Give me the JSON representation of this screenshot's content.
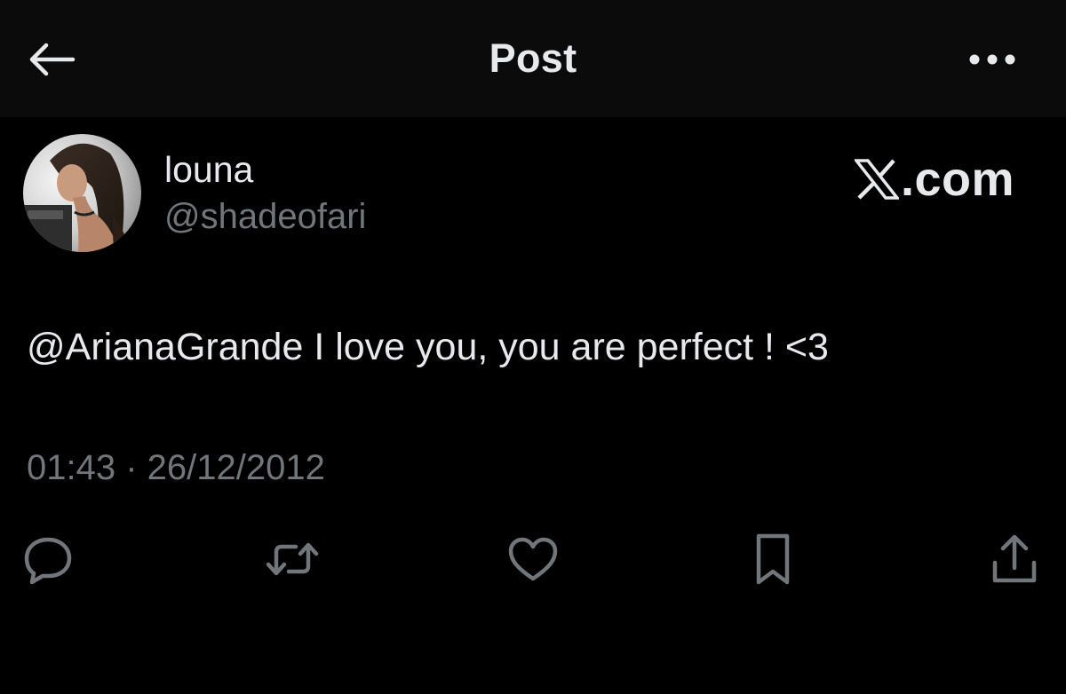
{
  "header": {
    "title": "Post",
    "back_icon": "arrow-left-icon",
    "more_icon": "more-horizontal-icon"
  },
  "post": {
    "author": {
      "display_name": "louna",
      "handle": "@shadeofari",
      "avatar_icon": "profile-avatar"
    },
    "brand": {
      "logo_icon": "x-logo-icon",
      "text": ".com"
    },
    "text": "@ArianaGrande I love you, you are perfect ! <3",
    "timestamp": "01:43 · 26/12/2012"
  },
  "actions": [
    {
      "name": "reply",
      "icon": "reply-icon"
    },
    {
      "name": "repost",
      "icon": "repost-icon"
    },
    {
      "name": "like",
      "icon": "heart-icon"
    },
    {
      "name": "bookmark",
      "icon": "bookmark-icon"
    },
    {
      "name": "share",
      "icon": "share-icon"
    }
  ],
  "colors": {
    "background": "#000000",
    "header_background": "#0b0b0b",
    "primary_text": "#e7e9ea",
    "secondary_text": "#71767b",
    "icon_gray": "#71767b"
  }
}
